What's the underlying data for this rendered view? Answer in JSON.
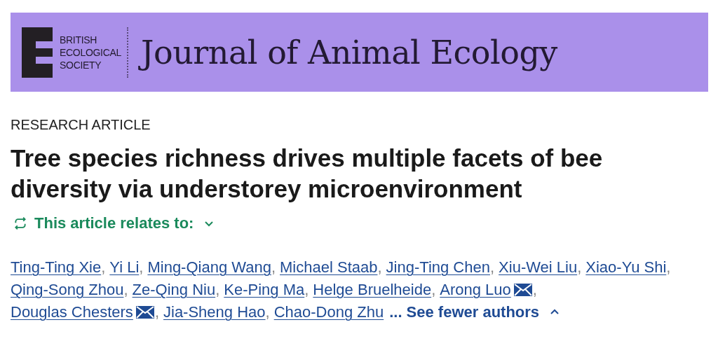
{
  "banner": {
    "society_lines": [
      "BRITISH",
      "ECOLOGICAL",
      "SOCIETY"
    ],
    "journal_title": "Journal of Animal Ecology"
  },
  "article_type": "RESEARCH ARTICLE",
  "title_lines": [
    "Tree species richness drives multiple facets of bee",
    "diversity via understorey microenvironment"
  ],
  "relates_to": {
    "label": "This article relates to:",
    "expanded": false
  },
  "author_lines": [
    [
      {
        "name": "Ting-Ting Xie",
        "email": false,
        "separator": ","
      },
      {
        "name": "Yi Li",
        "email": false,
        "separator": ","
      },
      {
        "name": "Ming-Qiang Wang",
        "email": false,
        "separator": ","
      },
      {
        "name": "Michael Staab",
        "email": false,
        "separator": ","
      },
      {
        "name": "Jing-Ting Chen",
        "email": false,
        "separator": ","
      },
      {
        "name": "Xiu-Wei Liu",
        "email": false,
        "separator": ","
      },
      {
        "name": "Xiao-Yu Shi",
        "email": false,
        "separator": ","
      }
    ],
    [
      {
        "name": "Qing-Song Zhou",
        "email": false,
        "separator": ","
      },
      {
        "name": "Ze-Qing Niu",
        "email": false,
        "separator": ","
      },
      {
        "name": "Ke-Ping Ma",
        "email": false,
        "separator": ","
      },
      {
        "name": "Helge Bruelheide",
        "email": false,
        "separator": ","
      },
      {
        "name": "Arong Luo",
        "email": true,
        "separator": ","
      }
    ],
    [
      {
        "name": "Douglas Chesters",
        "email": true,
        "separator": ","
      },
      {
        "name": "Jia-Sheng Hao",
        "email": false,
        "separator": ","
      },
      {
        "name": "Chao-Dong Zhu",
        "email": false
      }
    ]
  ],
  "authors_toggle": {
    "ellipsis": "...",
    "label": "See fewer authors",
    "expanded": true
  }
}
